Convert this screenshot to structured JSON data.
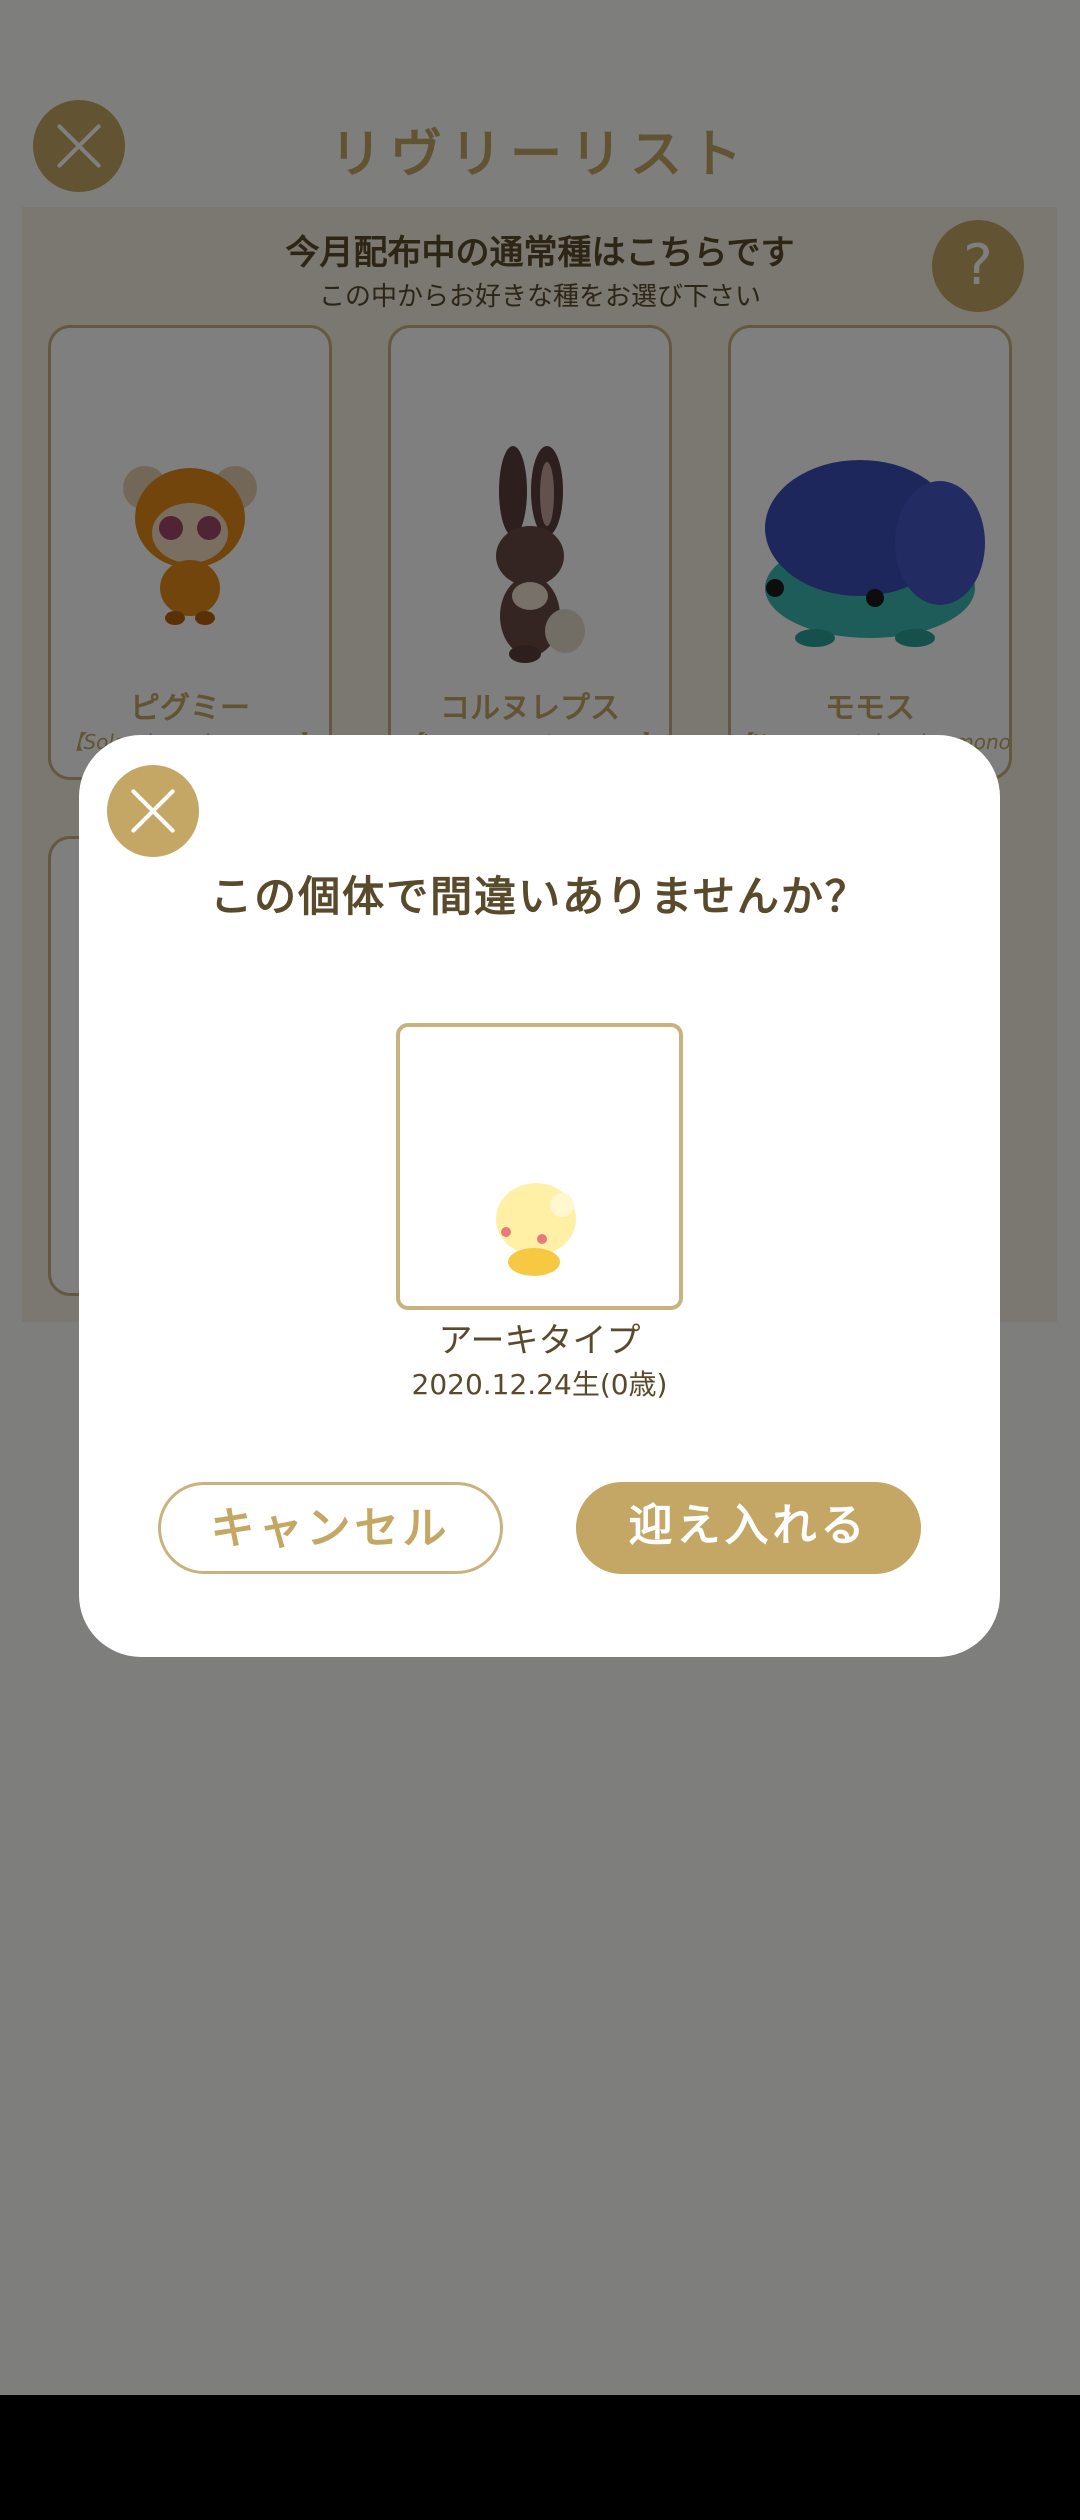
{
  "list_screen": {
    "title": "リヴリーリスト",
    "heading": "今月配布中の通常種はこちらです",
    "subheading": "この中からお好きな種をお選び下さい",
    "help_label": "?",
    "species": [
      {
        "name": "ピグミー",
        "latin": "【Solandos calva mono】"
      },
      {
        "name": "コルヌレプス",
        "latin": "【Lepus cornutus mono】"
      },
      {
        "name": "モモス",
        "latin": "【Nasus contabundus mono】"
      }
    ]
  },
  "confirm_dialog": {
    "question": "この個体で間違いありませんか？",
    "specimen_name": "アーキタイプ",
    "specimen_birth": "2020.12.24生(0歳)",
    "cancel_label": "キャンセル",
    "accept_label": "迎え入れる"
  },
  "colors": {
    "accent": "#c4a764",
    "text_dark": "#5a4a2c",
    "overlay": "rgba(0,0,0,0.5)"
  }
}
